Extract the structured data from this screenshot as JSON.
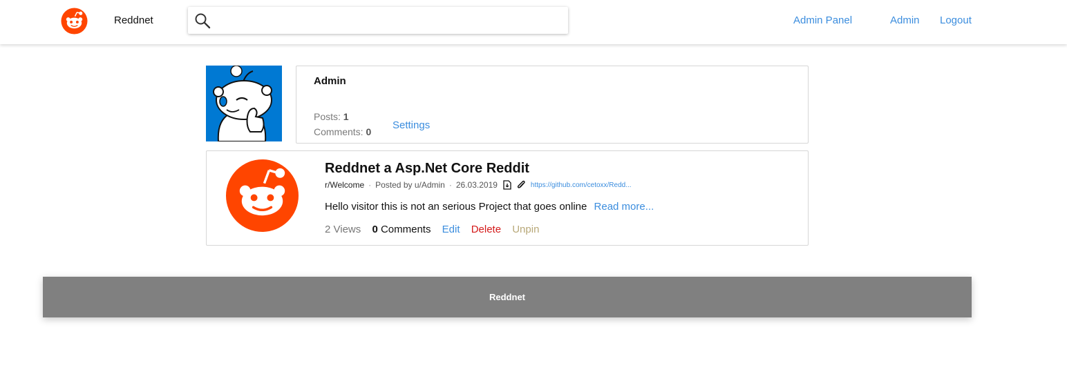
{
  "nav": {
    "brand": "Reddnet",
    "search_placeholder": "",
    "admin_panel": "Admin Panel",
    "user": "Admin",
    "logout": "Logout"
  },
  "profile": {
    "name": "Admin",
    "posts_label": "Posts:",
    "posts_count": "1",
    "comments_label": "Comments:",
    "comments_count": "0",
    "settings": "Settings"
  },
  "post": {
    "title": "Reddnet a Asp.Net Core Reddit",
    "subreddit": "r/Welcome",
    "author": "Posted by u/Admin",
    "date": "26.03.2019",
    "link": "https://github.com/cetoxx/Redd...",
    "excerpt": "Hello visitor this is not an serious Project that goes online",
    "read_more": "Read more...",
    "views": "2 Views",
    "comments_count": "0",
    "comments_label": "Comments",
    "edit": "Edit",
    "delete": "Delete",
    "unpin": "Unpin"
  },
  "footer": {
    "text": "Reddnet"
  },
  "colors": {
    "brand_orange": "#ff4500",
    "link_blue": "#3b8dde",
    "delete_red": "#d41a1a",
    "unpin_tan": "#b8a878",
    "avatar_blue": "#0079d3",
    "footer_gray": "#808080"
  },
  "icons": {
    "logo": "reddit-logo-icon",
    "search": "search-icon",
    "avatar": "snoo-avatar",
    "file": "file-icon",
    "attachment": "paperclip-icon"
  }
}
